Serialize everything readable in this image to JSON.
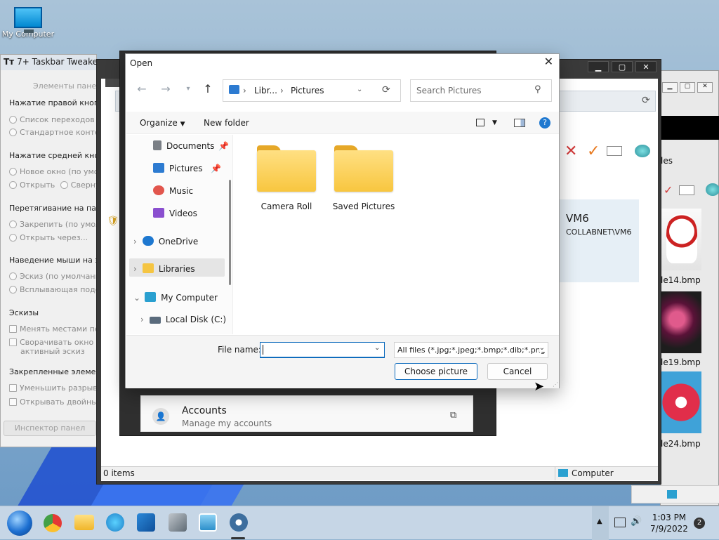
{
  "desktop": {
    "my_computer_label": "My Computer"
  },
  "tweaker": {
    "title": "7+ Taskbar Tweaker",
    "section_elements": "Элементы пане",
    "right_click": "Нажатие правой кноп",
    "jump_list": "Список переходов (",
    "std_menu": "Стандартное контек",
    "middle_click": "Нажатие средней кноп",
    "new_window": "Новое окно (по умол",
    "open": "Открыть",
    "collapse": "Сверну",
    "drag": "Перетягивание на пане",
    "pin": "Закрепить (по умолч",
    "open_via": "Открыть через...",
    "hover": "Наведение мыши на э",
    "thumb_default": "Эскиз (по умолчанию",
    "tooltip": "Всплывающая подск",
    "thumbs": "Эскизы",
    "swap": "Менять местами пере",
    "collapse_active": "Сворачивать окно на",
    "active_thumb": "активный эскиз",
    "pinned": "Закрепленные элемен",
    "reduce_gap": "Уменьшить разрыв м",
    "double_open": "Открывать двойным",
    "inspector": "Инспектор панел"
  },
  "settings": {
    "user_name": "VM6",
    "user_domain": "COLLABNET\\VM6",
    "accounts_title": "Accounts",
    "accounts_sub": "Manage my accounts",
    "status_items": "0 items",
    "status_location": "Computer"
  },
  "right_panel": {
    "files_label": "les",
    "img1": "le14.bmp",
    "img2": "le19.bmp",
    "img3": "le24.bmp"
  },
  "dialog": {
    "title": "Open",
    "breadcrumb": [
      "Libr...",
      "Pictures"
    ],
    "search_placeholder": "Search Pictures",
    "organize": "Organize",
    "new_folder": "New folder",
    "sidebar": [
      "Documents",
      "Pictures",
      "Music",
      "Videos",
      "OneDrive",
      "Libraries",
      "My Computer",
      "Local Disk (C:)"
    ],
    "folders": [
      "Camera Roll",
      "Saved Pictures"
    ],
    "file_name_label": "File name:",
    "file_name_value": "",
    "file_type": "All files (*.jpg;*.jpeg;*.bmp;*.dib;*.png",
    "choose": "Choose picture",
    "cancel": "Cancel"
  },
  "taskbar": {
    "time": "1:03 PM",
    "date": "7/9/2022",
    "notifications": "2"
  }
}
